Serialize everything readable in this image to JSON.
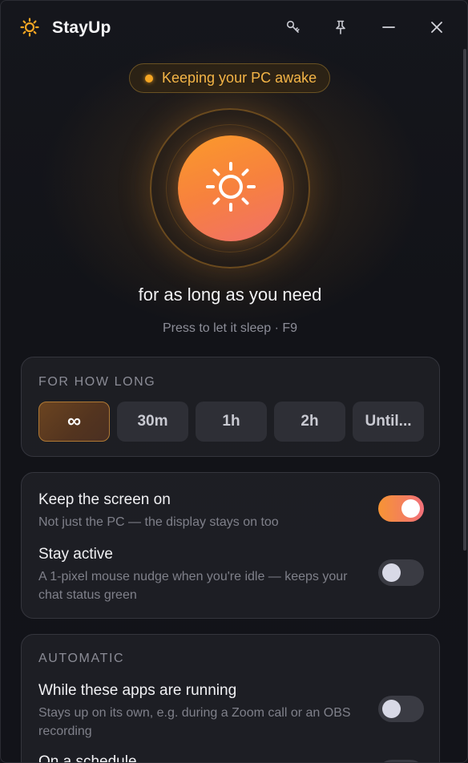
{
  "app": {
    "title": "StayUp"
  },
  "titlebar": {
    "buttons": [
      {
        "name": "key-icon"
      },
      {
        "name": "pin-icon"
      },
      {
        "name": "minimize-icon"
      },
      {
        "name": "close-icon"
      }
    ]
  },
  "status": {
    "text": "Keeping your PC awake",
    "dot_color": "#f5a623"
  },
  "power": {
    "duration_text": "for as long as you need",
    "hint": "Press to let it sleep · F9"
  },
  "duration": {
    "section_label": "FOR HOW LONG",
    "options": [
      {
        "label": "∞",
        "selected": true
      },
      {
        "label": "30m",
        "selected": false
      },
      {
        "label": "1h",
        "selected": false
      },
      {
        "label": "2h",
        "selected": false
      },
      {
        "label": "Until...",
        "selected": false
      }
    ]
  },
  "options": [
    {
      "title": "Keep the screen on",
      "subtitle": "Not just the PC — the display stays on too",
      "enabled": true
    },
    {
      "title": "Stay active",
      "subtitle": "A 1-pixel mouse nudge when you're idle — keeps your chat status green",
      "enabled": false
    }
  ],
  "automatic": {
    "section_label": "AUTOMATIC",
    "items": [
      {
        "title": "While these apps are running",
        "subtitle": "Stays up on its own, e.g. during a Zoom call or an OBS recording",
        "enabled": false
      },
      {
        "title": "On a schedule",
        "enabled": false
      }
    ]
  },
  "colors": {
    "accent_start": "#fb9a2a",
    "accent_end": "#f06f6a",
    "status_text": "#f4b547"
  }
}
